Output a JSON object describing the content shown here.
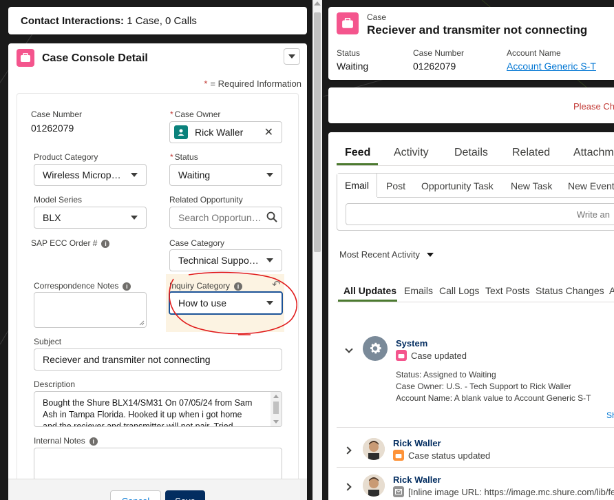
{
  "contact_interactions": {
    "label": "Contact Interactions:",
    "summary": "1 Case, 0 Calls"
  },
  "case_detail": {
    "title": "Case Console Detail",
    "required_star": "*",
    "required_text": "= Required Information",
    "fields": {
      "case_number_label": "Case Number",
      "case_number_value": "01262079",
      "case_owner_label": "Case Owner",
      "case_owner_value": "Rick Waller",
      "product_category_label": "Product Category",
      "product_category_value": "Wireless Micropho...",
      "status_label": "Status",
      "status_value": "Waiting",
      "model_series_label": "Model Series",
      "model_series_value": "BLX",
      "related_opportunity_label": "Related Opportunity",
      "related_opportunity_placeholder": "Search Opportunities",
      "sap_ecc_order_label": "SAP ECC Order #",
      "case_category_label": "Case Category",
      "case_category_value": "Technical Support ...",
      "correspondence_notes_label": "Correspondence Notes",
      "inquiry_category_label": "Inquiry Category",
      "inquiry_category_value": "How to use",
      "subject_label": "Subject",
      "subject_value": "Reciever and transmiter not connecting",
      "description_label": "Description",
      "description_line1": "Bought the Shure BLX14/SM31 On 07/05/24 from Sam",
      "description_line2": "Ash in Tampa Florida. Hooked it up when i got home",
      "description_line3": "and the reciever and transmitter will not pair. Tried",
      "internal_notes_label": "Internal Notes"
    },
    "buttons": {
      "cancel": "Cancel",
      "save": "Save"
    }
  },
  "record_header": {
    "object_label": "Case",
    "title": "Reciever and transmiter not connecting",
    "status_label": "Status",
    "status_value": "Waiting",
    "case_number_label": "Case Number",
    "case_number_value": "01262079",
    "account_name_label": "Account Name",
    "account_name_value": "Account Generic S-T"
  },
  "alert": {
    "text": "Please Che"
  },
  "feed": {
    "tabs": [
      "Feed",
      "Activity",
      "Details",
      "Related",
      "Attachm"
    ],
    "publisher_tabs": [
      "Email",
      "Post",
      "Opportunity Task",
      "New Task",
      "New Event"
    ],
    "publisher_placeholder": "Write an",
    "sort_label": "Most Recent Activity",
    "filter_tabs": [
      "All Updates",
      "Emails",
      "Call Logs",
      "Text Posts",
      "Status Changes",
      "A"
    ],
    "items": [
      {
        "name": "System",
        "action": "Case updated",
        "details": [
          "Status: Assigned to Waiting",
          "Case Owner: U.S. - Tech Support to Rick Waller",
          "Account Name: A blank value to Account Generic S-T"
        ],
        "show_more": "Sh"
      },
      {
        "name": "Rick Waller",
        "action": "Case status updated"
      },
      {
        "name": "Rick Waller",
        "action": "[Inline image URL: https://image.mc.shure.com/lib/fe"
      }
    ]
  },
  "colors": {
    "case_icon": "#f4558d",
    "link": "#0176d3",
    "active_tab": "#4c7a30",
    "save_button": "#032d60",
    "annotation": "#e01b1b"
  }
}
